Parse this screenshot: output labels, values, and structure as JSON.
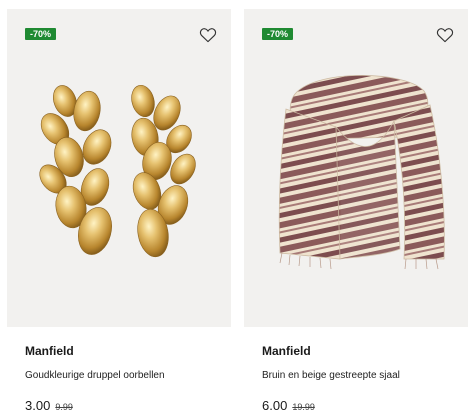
{
  "products": [
    {
      "discount_badge": "-70%",
      "brand": "Manfield",
      "name": "Goudkleurige druppel oorbellen",
      "price": "3.00",
      "old_price": "9.99",
      "image_icon": "gold-earrings-image",
      "favorite_icon": "heart-icon"
    },
    {
      "discount_badge": "-70%",
      "brand": "Manfield",
      "name": "Bruin en beige gestreepte sjaal",
      "price": "6.00",
      "old_price": "19.99",
      "image_icon": "striped-scarf-image",
      "favorite_icon": "heart-icon"
    }
  ],
  "colors": {
    "badge": "#1f8a32",
    "card_bg": "#f2f1ef",
    "gold": "#d8b25c",
    "scarf_brown": "#8b5a5a",
    "scarf_beige": "#efe3cf"
  }
}
